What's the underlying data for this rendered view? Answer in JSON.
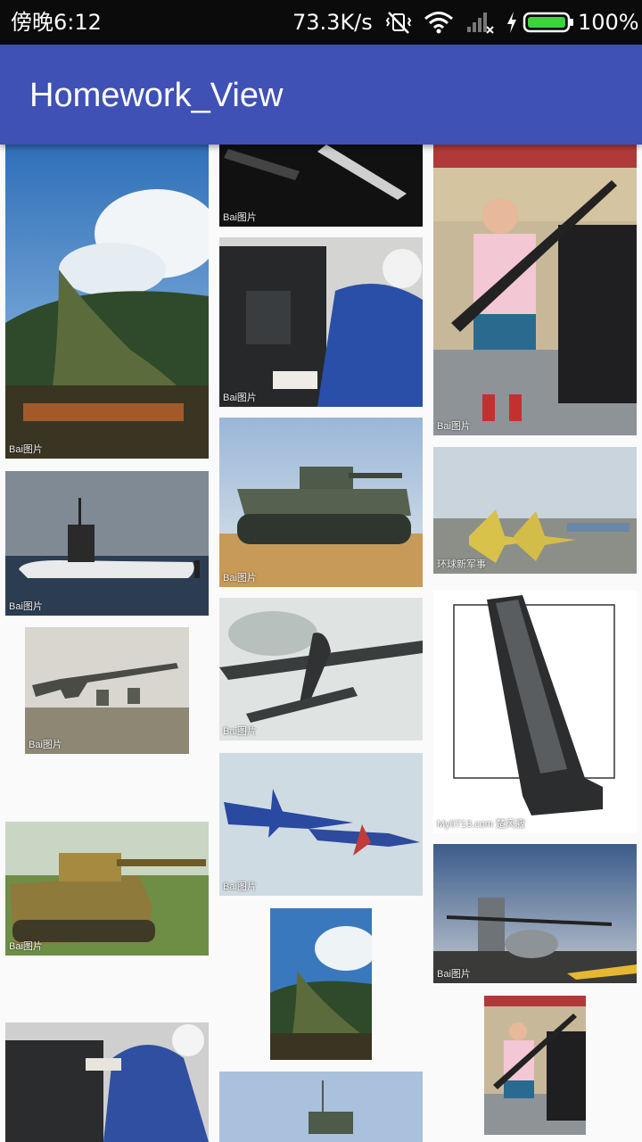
{
  "status_bar": {
    "time": "傍晚6:12",
    "network_speed": "73.3K/s",
    "battery": "100%",
    "icons": [
      "mute-vibrate-icon",
      "wifi-icon",
      "signal-icon",
      "charging-icon",
      "battery-icon"
    ]
  },
  "app_bar": {
    "title": "Homework_View",
    "color": "#3f51b5"
  },
  "grid": {
    "columns": 3,
    "images": [
      {
        "subject": "camouflage-net",
        "watermark": "Bai图片"
      },
      {
        "subject": "submarine",
        "watermark": "Bai图片"
      },
      {
        "subject": "rifle",
        "watermark": "Bai图片"
      },
      {
        "subject": "tiger-tank",
        "watermark": "Bai图片"
      },
      {
        "subject": "cockpit-pilot",
        "watermark": ""
      },
      {
        "subject": "gun-barrel",
        "watermark": "Bai图片"
      },
      {
        "subject": "cockpit-pilot",
        "watermark": "Bai图片"
      },
      {
        "subject": "tank",
        "watermark": "Bai图片"
      },
      {
        "subject": "bomber-plane",
        "watermark": "Bai图片"
      },
      {
        "subject": "fighter-jets",
        "watermark": "Bai图片"
      },
      {
        "subject": "camouflage-net",
        "watermark": ""
      },
      {
        "subject": "tank",
        "watermark": ""
      },
      {
        "subject": "gun-store-man",
        "watermark": "Bai图片"
      },
      {
        "subject": "parked-jets",
        "watermark": "环球新军事"
      },
      {
        "subject": "pistol-magazine",
        "watermark": "My0713.com 楚风寂"
      },
      {
        "subject": "helicopter-deck",
        "watermark": "Bai图片"
      },
      {
        "subject": "gun-store-man",
        "watermark": ""
      }
    ]
  }
}
